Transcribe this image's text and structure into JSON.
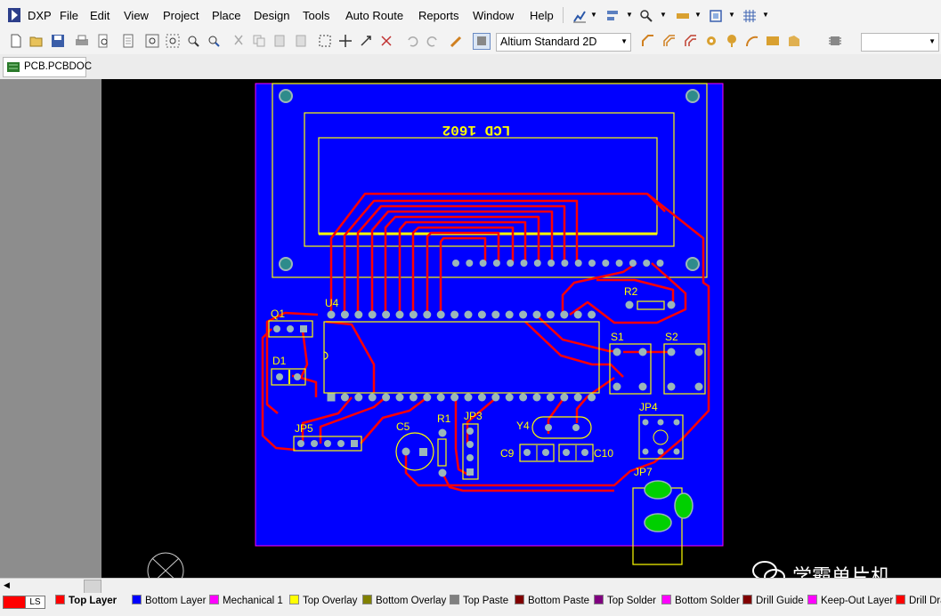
{
  "app": {
    "name": "DXP",
    "document_tab": "PCB.PCBDOC"
  },
  "menu": [
    "File",
    "Edit",
    "View",
    "Project",
    "Place",
    "Design",
    "Tools",
    "Auto Route",
    "Reports",
    "Window",
    "Help"
  ],
  "view_mode": "Altium Standard 2D",
  "ls_label": "LS",
  "layers": [
    {
      "name": "Top Layer",
      "color": "#ff0000",
      "active": true
    },
    {
      "name": "Bottom Layer",
      "color": "#0000ff"
    },
    {
      "name": "Mechanical 1",
      "color": "#ff00ff"
    },
    {
      "name": "Top Overlay",
      "color": "#ffff00"
    },
    {
      "name": "Bottom Overlay",
      "color": "#808000"
    },
    {
      "name": "Top Paste",
      "color": "#808080"
    },
    {
      "name": "Bottom Paste",
      "color": "#800000"
    },
    {
      "name": "Top Solder",
      "color": "#800080"
    },
    {
      "name": "Bottom Solder",
      "color": "#ff00ff"
    },
    {
      "name": "Drill Guide",
      "color": "#800000"
    },
    {
      "name": "Keep-Out Layer",
      "color": "#ff00ff"
    },
    {
      "name": "Drill Dra",
      "color": "#ff0000"
    }
  ],
  "designators": {
    "lcd": "LCD  1602",
    "u4": "U4",
    "q1": "Q1",
    "d1": "D1",
    "r2": "R2",
    "s1": "S1",
    "s2": "S2",
    "jp5": "JP5",
    "c5": "C5",
    "r1": "R1",
    "jp3": "JP3",
    "y4": "Y4",
    "c9": "C9",
    "c10": "C10",
    "jp4": "JP4",
    "jp7": "JP7"
  },
  "watermark": "学霸单片机",
  "colors": {
    "board": "#0000ff",
    "track": "#ff0000",
    "silk": "#ffff00",
    "pad": "#9bb7b9",
    "canvas": "#000000"
  }
}
